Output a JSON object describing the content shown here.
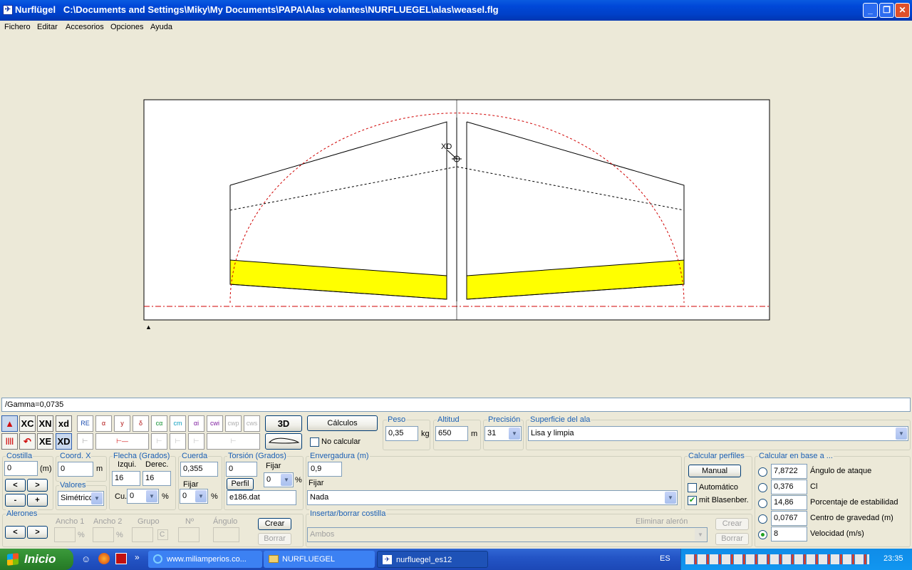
{
  "window": {
    "app": "Nurflügel",
    "path": "C:\\Documents and Settings\\Miky\\My Documents\\PAPA\\Alas volantes\\NURFLUEGEL\\alas\\weasel.flg",
    "min_glyph": "_",
    "max_glyph": "❐",
    "close_glyph": "✕"
  },
  "menu": [
    "Fichero",
    "Editar",
    "Accesorios",
    "Opciones",
    "Ayuda"
  ],
  "drawing": {
    "point_label": "XD",
    "marker": "▲"
  },
  "status_text": "/Gamma=0,0735",
  "toolbar": {
    "row1": [
      "XC",
      "XN",
      "xd"
    ],
    "row2": [
      "XE",
      "XD"
    ],
    "curve_tools": [
      "RE",
      "α",
      "y",
      "δ",
      "cα",
      "cm",
      "αi",
      "cwi",
      "cwp",
      "cws"
    ],
    "btn_3d": "3D",
    "btn_calc": "Cálculos",
    "no_calc": "No calcular"
  },
  "peso": {
    "title": "Peso",
    "value": "0,35",
    "unit": "kg"
  },
  "altitud": {
    "title": "Altitud",
    "value": "650",
    "unit": "m"
  },
  "precision": {
    "title": "Precisión",
    "value": "31"
  },
  "superficie": {
    "title": "Superficie del ala",
    "value": "Lisa y limpia"
  },
  "costilla": {
    "title": "Costilla",
    "value": "0",
    "unit": "(m)",
    "prev": "<",
    "next": ">",
    "minus": "-",
    "plus": "+"
  },
  "coordx": {
    "title": "Coord. X",
    "value": "0",
    "unit": "m"
  },
  "valores": {
    "title": "Valores",
    "value": "Simétrico"
  },
  "flecha": {
    "title": "Flecha (Grados)",
    "izq_label": "Izqui.",
    "der_label": "Derec.",
    "izq": "16",
    "der": "16",
    "cu_label": "Cu.",
    "cu": "0",
    "pct": "%"
  },
  "cuerda": {
    "title": "Cuerda",
    "value": "0,355",
    "fijar": "Fijar",
    "fijar_value": "0",
    "pct": "%"
  },
  "torsion": {
    "title": "Torsión (Grados)",
    "value": "0",
    "fijar": "Fijar",
    "fijar_value": "0",
    "pct": "%",
    "perfil_btn": "Perfil",
    "perfil_file": "e186.dat"
  },
  "envergadura": {
    "title": "Envergadura (m)",
    "value": "0,9",
    "fijar": "Fijar",
    "fijar_value": "Nada"
  },
  "calc_perfiles": {
    "title": "Calcular perfiles",
    "manual": "Manual",
    "automatico": "Automático",
    "blasenber": "mit Blasenber."
  },
  "calc_base": {
    "title": "Calcular en base a ...",
    "rows": [
      {
        "value": "7,8722",
        "label": "Ángulo de ataque"
      },
      {
        "value": "0,376",
        "label": "Cl"
      },
      {
        "value": "14,86",
        "label": "Porcentaje de estabilidad"
      },
      {
        "value": "0,0767",
        "label": "Centro de gravedad (m)"
      },
      {
        "value": "8",
        "label": "Velocidad (m/s)"
      }
    ],
    "selected": 4
  },
  "alerones": {
    "title": "Alerones",
    "prev": "<",
    "next": ">",
    "ancho1": "Ancho 1",
    "ancho2": "Ancho 2",
    "grupo": "Grupo",
    "num": "Nº",
    "angulo": "Ángulo",
    "pct": "%",
    "c": "C",
    "crear": "Crear",
    "borrar": "Borrar"
  },
  "insertar": {
    "title": "Insertar/borrar costilla",
    "eliminar": "Eliminar alerón",
    "ambos": "Ambos",
    "crear": "Crear",
    "borrar": "Borrar"
  },
  "taskbar": {
    "start": "Inicio",
    "tasks": [
      "www.miliamperios.co...",
      "NURFLUEGEL",
      "nurfluegel_es12"
    ],
    "arrows": "»",
    "lang": "ES",
    "clock": "23:35"
  },
  "colors": {
    "titlebar": "#0a5ae0",
    "yellow": "#ffff00",
    "red": "#d00000",
    "groupLabel": "#1a5fb4"
  }
}
